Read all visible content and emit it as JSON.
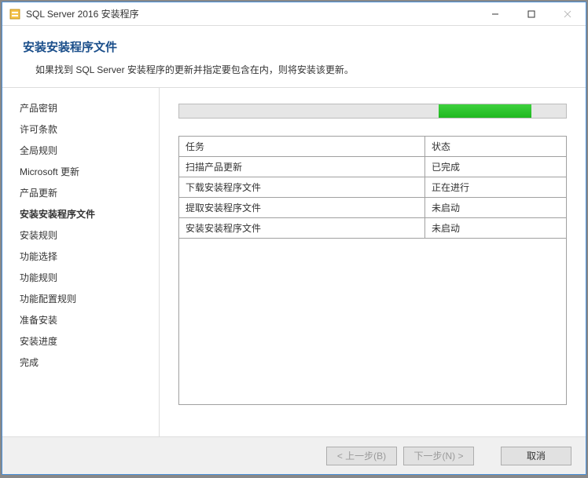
{
  "window": {
    "title": "SQL Server 2016 安装程序"
  },
  "header": {
    "title": "安装安装程序文件",
    "description": "如果找到 SQL Server 安装程序的更新并指定要包含在内，则将安装该更新。"
  },
  "sidebar": {
    "items": [
      {
        "label": "产品密钥",
        "active": false
      },
      {
        "label": "许可条款",
        "active": false
      },
      {
        "label": "全局规则",
        "active": false
      },
      {
        "label": "Microsoft 更新",
        "active": false
      },
      {
        "label": "产品更新",
        "active": false
      },
      {
        "label": "安装安装程序文件",
        "active": true
      },
      {
        "label": "安装规则",
        "active": false
      },
      {
        "label": "功能选择",
        "active": false
      },
      {
        "label": "功能规则",
        "active": false
      },
      {
        "label": "功能配置规则",
        "active": false
      },
      {
        "label": "准备安装",
        "active": false
      },
      {
        "label": "安装进度",
        "active": false
      },
      {
        "label": "完成",
        "active": false
      }
    ]
  },
  "task_table": {
    "headers": {
      "task": "任务",
      "status": "状态"
    },
    "rows": [
      {
        "task": "扫描产品更新",
        "status": "已完成"
      },
      {
        "task": "下载安装程序文件",
        "status": "正在进行"
      },
      {
        "task": "提取安装程序文件",
        "status": "未启动"
      },
      {
        "task": "安装安装程序文件",
        "status": "未启动"
      }
    ]
  },
  "footer": {
    "back": "< 上一步(B)",
    "next": "下一步(N) >",
    "cancel": "取消"
  },
  "colors": {
    "progress_green": "#1fb81f"
  }
}
